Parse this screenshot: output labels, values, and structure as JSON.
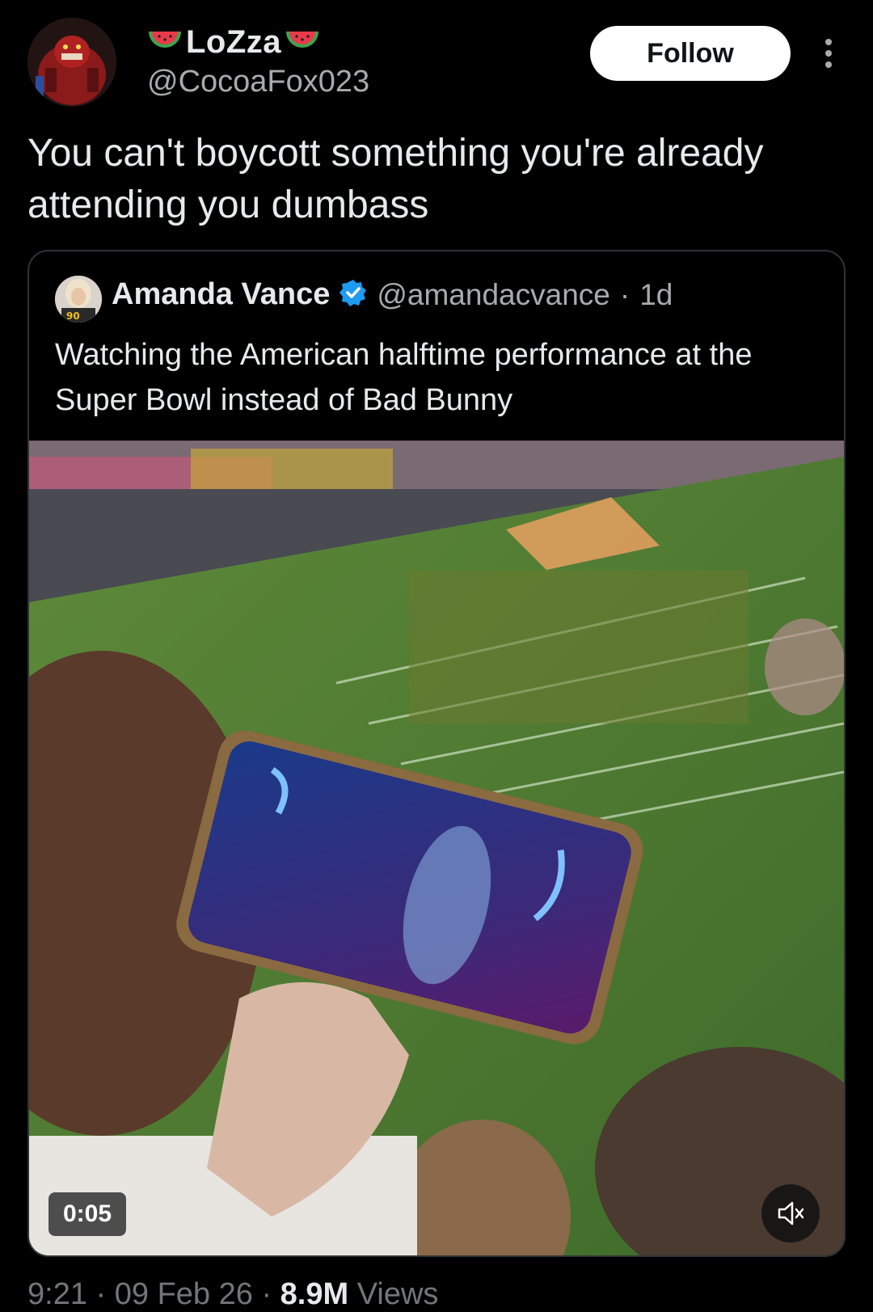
{
  "author": {
    "display_name": "LoZza",
    "handle": "@CocoaFox023",
    "follow_label": "Follow"
  },
  "tweet": {
    "text": "You can't boycott something you're already attending you dumbass",
    "time": "9:21",
    "date": "09 Feb 26",
    "views_count": "8.9M",
    "views_label": "Views"
  },
  "quoted": {
    "name": "Amanda Vance",
    "handle": "@amandacvance",
    "age": "1d",
    "text": "Watching the American halftime performance at the Super Bowl instead of Bad Bunny",
    "video_duration": "0:05"
  },
  "separator": "·",
  "colors": {
    "background": "#000000",
    "verified": "#1d9bf0",
    "secondary_text": "#72767b",
    "follow_button_bg": "#ffffff"
  },
  "icons": [
    "watermelon-icon",
    "more-icon",
    "verified-badge-icon",
    "mute-icon"
  ]
}
